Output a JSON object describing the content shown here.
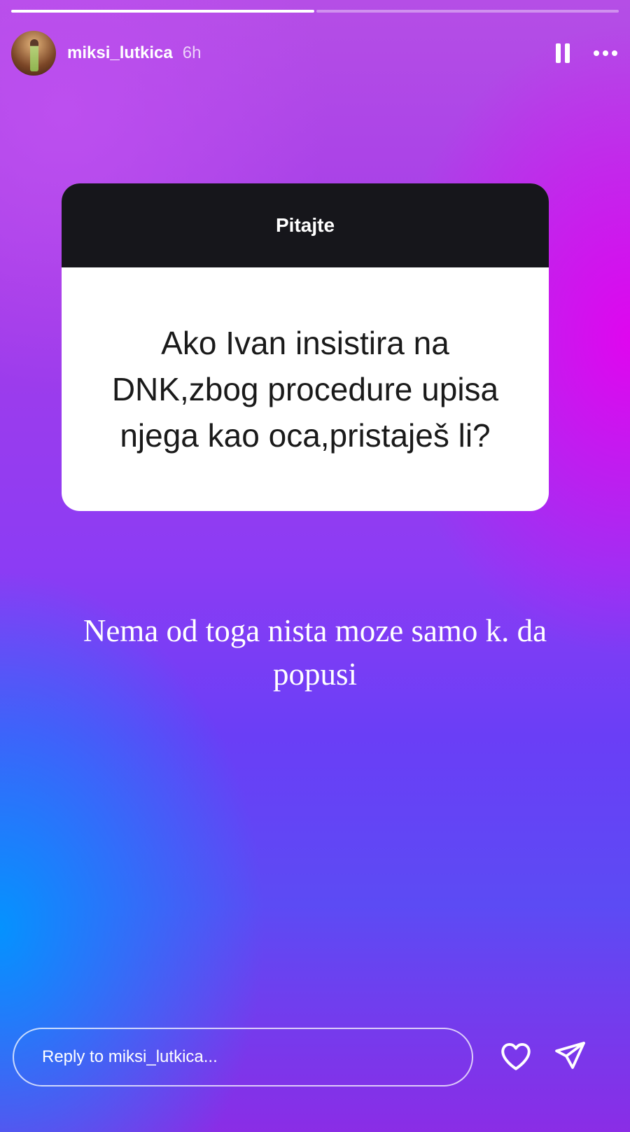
{
  "progress": {
    "total_segments": 2,
    "completed_segments": 1
  },
  "header": {
    "username": "miksi_lutkica",
    "time": "6h",
    "pause_icon": "pause-icon",
    "more_icon": "more-horizontal-icon"
  },
  "question_card": {
    "title": "Pitajte",
    "question": "Ako Ivan insistira na DNK,zbog procedure upisa njega kao oca,pristaješ li?"
  },
  "answer_text": "Nema od toga nista moze samo k. da popusi",
  "reply": {
    "placeholder": "Reply to miksi_lutkica...",
    "like_icon": "heart-icon",
    "send_icon": "send-icon"
  },
  "colors": {
    "card_header": "#16161b",
    "card_body": "#ffffff",
    "text_light": "#ffffff",
    "text_dark": "#1a1a1a"
  }
}
